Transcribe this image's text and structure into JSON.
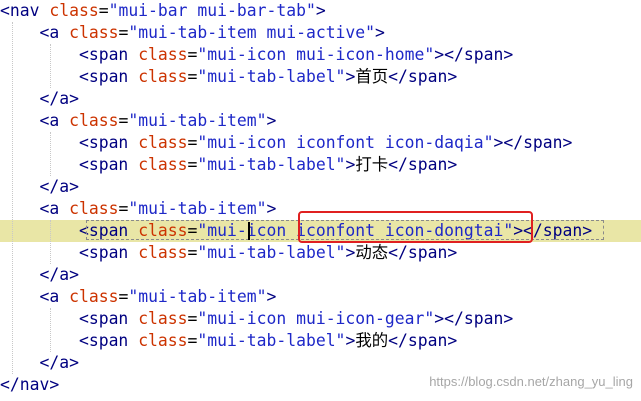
{
  "editor": {
    "lines": [
      {
        "indent": "",
        "tokens": [
          {
            "t": "<",
            "c": "punct"
          },
          {
            "t": "nav",
            "c": "tag"
          },
          {
            "t": " ",
            "c": "text"
          },
          {
            "t": "class",
            "c": "attr"
          },
          {
            "t": "=",
            "c": "eq"
          },
          {
            "t": "\"mui-bar mui-bar-tab\"",
            "c": "str"
          },
          {
            "t": ">",
            "c": "punct"
          }
        ]
      },
      {
        "indent": "    ",
        "tokens": [
          {
            "t": "<",
            "c": "punct"
          },
          {
            "t": "a",
            "c": "tag"
          },
          {
            "t": " ",
            "c": "text"
          },
          {
            "t": "class",
            "c": "attr"
          },
          {
            "t": "=",
            "c": "eq"
          },
          {
            "t": "\"mui-tab-item mui-active\"",
            "c": "str"
          },
          {
            "t": ">",
            "c": "punct"
          }
        ]
      },
      {
        "indent": "        ",
        "tokens": [
          {
            "t": "<",
            "c": "punct"
          },
          {
            "t": "span",
            "c": "tag"
          },
          {
            "t": " ",
            "c": "text"
          },
          {
            "t": "class",
            "c": "attr"
          },
          {
            "t": "=",
            "c": "eq"
          },
          {
            "t": "\"mui-icon mui-icon-home\"",
            "c": "str"
          },
          {
            "t": "></",
            "c": "punct"
          },
          {
            "t": "span",
            "c": "tag"
          },
          {
            "t": ">",
            "c": "punct"
          }
        ]
      },
      {
        "indent": "        ",
        "tokens": [
          {
            "t": "<",
            "c": "punct"
          },
          {
            "t": "span",
            "c": "tag"
          },
          {
            "t": " ",
            "c": "text"
          },
          {
            "t": "class",
            "c": "attr"
          },
          {
            "t": "=",
            "c": "eq"
          },
          {
            "t": "\"mui-tab-label\"",
            "c": "str"
          },
          {
            "t": ">",
            "c": "punct"
          },
          {
            "t": "首页",
            "c": "text"
          },
          {
            "t": "</",
            "c": "punct"
          },
          {
            "t": "span",
            "c": "tag"
          },
          {
            "t": ">",
            "c": "punct"
          }
        ]
      },
      {
        "indent": "    ",
        "tokens": [
          {
            "t": "</",
            "c": "punct"
          },
          {
            "t": "a",
            "c": "tag"
          },
          {
            "t": ">",
            "c": "punct"
          }
        ]
      },
      {
        "indent": "    ",
        "tokens": [
          {
            "t": "<",
            "c": "punct"
          },
          {
            "t": "a",
            "c": "tag"
          },
          {
            "t": " ",
            "c": "text"
          },
          {
            "t": "class",
            "c": "attr"
          },
          {
            "t": "=",
            "c": "eq"
          },
          {
            "t": "\"mui-tab-item\"",
            "c": "str"
          },
          {
            "t": ">",
            "c": "punct"
          }
        ]
      },
      {
        "indent": "        ",
        "tokens": [
          {
            "t": "<",
            "c": "punct"
          },
          {
            "t": "span",
            "c": "tag"
          },
          {
            "t": " ",
            "c": "text"
          },
          {
            "t": "class",
            "c": "attr"
          },
          {
            "t": "=",
            "c": "eq"
          },
          {
            "t": "\"mui-icon iconfont icon-daqia\"",
            "c": "str"
          },
          {
            "t": "></",
            "c": "punct"
          },
          {
            "t": "span",
            "c": "tag"
          },
          {
            "t": ">",
            "c": "punct"
          }
        ]
      },
      {
        "indent": "        ",
        "tokens": [
          {
            "t": "<",
            "c": "punct"
          },
          {
            "t": "span",
            "c": "tag"
          },
          {
            "t": " ",
            "c": "text"
          },
          {
            "t": "class",
            "c": "attr"
          },
          {
            "t": "=",
            "c": "eq"
          },
          {
            "t": "\"mui-tab-label\"",
            "c": "str"
          },
          {
            "t": ">",
            "c": "punct"
          },
          {
            "t": "打卡",
            "c": "text"
          },
          {
            "t": "</",
            "c": "punct"
          },
          {
            "t": "span",
            "c": "tag"
          },
          {
            "t": ">",
            "c": "punct"
          }
        ]
      },
      {
        "indent": "    ",
        "tokens": [
          {
            "t": "</",
            "c": "punct"
          },
          {
            "t": "a",
            "c": "tag"
          },
          {
            "t": ">",
            "c": "punct"
          }
        ]
      },
      {
        "indent": "    ",
        "tokens": [
          {
            "t": "<",
            "c": "punct"
          },
          {
            "t": "a",
            "c": "tag"
          },
          {
            "t": " ",
            "c": "text"
          },
          {
            "t": "class",
            "c": "attr"
          },
          {
            "t": "=",
            "c": "eq"
          },
          {
            "t": "\"mui-tab-item\"",
            "c": "str"
          },
          {
            "t": ">",
            "c": "punct"
          }
        ]
      },
      {
        "indent": "        ",
        "highlighted": true,
        "tokens": [
          {
            "t": "<",
            "c": "punct"
          },
          {
            "t": "span",
            "c": "tag"
          },
          {
            "t": " ",
            "c": "text"
          },
          {
            "t": "class",
            "c": "attr"
          },
          {
            "t": "=",
            "c": "eq"
          },
          {
            "t": "\"mui-icon iconfont icon-dongtai\"",
            "c": "str"
          },
          {
            "t": "></",
            "c": "punct"
          },
          {
            "t": "span",
            "c": "tag"
          },
          {
            "t": ">",
            "c": "punct"
          }
        ]
      },
      {
        "indent": "        ",
        "tokens": [
          {
            "t": "<",
            "c": "punct"
          },
          {
            "t": "span",
            "c": "tag"
          },
          {
            "t": " ",
            "c": "text"
          },
          {
            "t": "class",
            "c": "attr"
          },
          {
            "t": "=",
            "c": "eq"
          },
          {
            "t": "\"mui-tab-label\"",
            "c": "str"
          },
          {
            "t": ">",
            "c": "punct"
          },
          {
            "t": "动态",
            "c": "text"
          },
          {
            "t": "</",
            "c": "punct"
          },
          {
            "t": "span",
            "c": "tag"
          },
          {
            "t": ">",
            "c": "punct"
          }
        ]
      },
      {
        "indent": "    ",
        "tokens": [
          {
            "t": "</",
            "c": "punct"
          },
          {
            "t": "a",
            "c": "tag"
          },
          {
            "t": ">",
            "c": "punct"
          }
        ]
      },
      {
        "indent": "    ",
        "tokens": [
          {
            "t": "<",
            "c": "punct"
          },
          {
            "t": "a",
            "c": "tag"
          },
          {
            "t": " ",
            "c": "text"
          },
          {
            "t": "class",
            "c": "attr"
          },
          {
            "t": "=",
            "c": "eq"
          },
          {
            "t": "\"mui-tab-item\"",
            "c": "str"
          },
          {
            "t": ">",
            "c": "punct"
          }
        ]
      },
      {
        "indent": "        ",
        "tokens": [
          {
            "t": "<",
            "c": "punct"
          },
          {
            "t": "span",
            "c": "tag"
          },
          {
            "t": " ",
            "c": "text"
          },
          {
            "t": "class",
            "c": "attr"
          },
          {
            "t": "=",
            "c": "eq"
          },
          {
            "t": "\"mui-icon mui-icon-gear\"",
            "c": "str"
          },
          {
            "t": "></",
            "c": "punct"
          },
          {
            "t": "span",
            "c": "tag"
          },
          {
            "t": ">",
            "c": "punct"
          }
        ]
      },
      {
        "indent": "        ",
        "tokens": [
          {
            "t": "<",
            "c": "punct"
          },
          {
            "t": "span",
            "c": "tag"
          },
          {
            "t": " ",
            "c": "text"
          },
          {
            "t": "class",
            "c": "attr"
          },
          {
            "t": "=",
            "c": "eq"
          },
          {
            "t": "\"mui-tab-label\"",
            "c": "str"
          },
          {
            "t": ">",
            "c": "punct"
          },
          {
            "t": "我的",
            "c": "text"
          },
          {
            "t": "</",
            "c": "punct"
          },
          {
            "t": "span",
            "c": "tag"
          },
          {
            "t": ">",
            "c": "punct"
          }
        ]
      },
      {
        "indent": "    ",
        "tokens": [
          {
            "t": "</",
            "c": "punct"
          },
          {
            "t": "a",
            "c": "tag"
          },
          {
            "t": ">",
            "c": "punct"
          }
        ]
      },
      {
        "indent": "",
        "tokens": [
          {
            "t": "</",
            "c": "punct"
          },
          {
            "t": "nav",
            "c": "tag"
          },
          {
            "t": ">",
            "c": "punct"
          }
        ]
      }
    ]
  },
  "watermark": "https://blog.csdn.net/zhang_yu_ling",
  "colors": {
    "tag": "#000080",
    "attribute": "#cc3300",
    "string": "#1e28c8",
    "text": "#000000",
    "line_highlight": "#e9e6a6",
    "annotation_box": "#e02020"
  }
}
